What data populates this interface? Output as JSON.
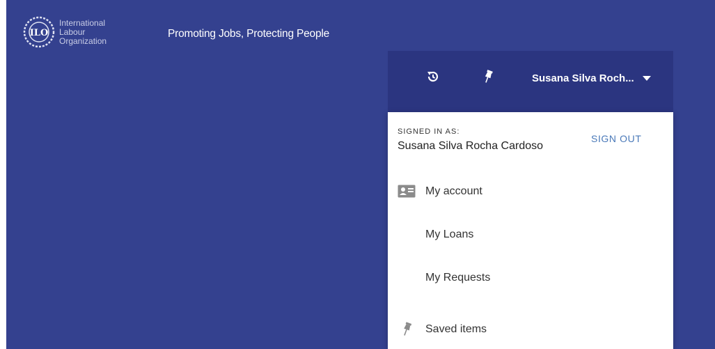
{
  "header": {
    "org_name_line1": "International",
    "org_name_line2": "Labour",
    "org_name_line3": "Organization",
    "logo_lettering": "ILO",
    "tagline": "Promoting Jobs, Protecting People"
  },
  "user_bar": {
    "user_name_truncated": "Susana Silva Roch...",
    "history_icon": "history-icon",
    "pin_icon": "pushpin-icon",
    "caret_icon": "caret-down-icon"
  },
  "dropdown": {
    "signed_in_label": "SIGNED IN AS:",
    "signed_in_name": "Susana Silva Rocha Cardoso",
    "sign_out_label": "SIGN OUT",
    "items": [
      {
        "label": "My account",
        "icon": "id-card-icon"
      },
      {
        "label": "My Loans"
      },
      {
        "label": "My Requests"
      },
      {
        "label": "Saved items",
        "icon": "pushpin-icon"
      }
    ]
  },
  "colors": {
    "background": "#34418f",
    "user_bar": "#2b3580",
    "link": "#4a79b9"
  }
}
